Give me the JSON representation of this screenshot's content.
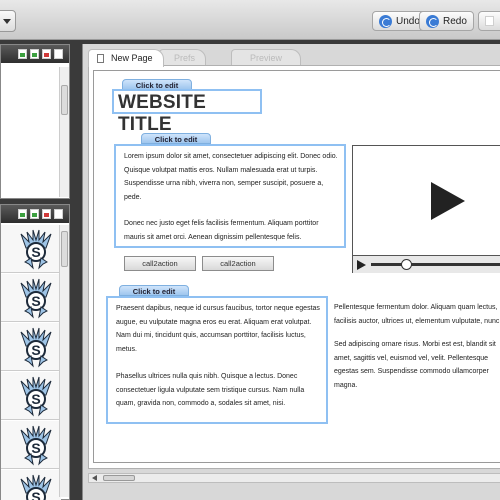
{
  "toolbar": {
    "undo_label": "Undo",
    "redo_label": "Redo"
  },
  "tabs": [
    {
      "label": "New Page",
      "active": true
    },
    {
      "label": "Prefs",
      "active": false
    },
    {
      "label": "Preview",
      "active": false
    }
  ],
  "canvas": {
    "edit_label": "Click to edit",
    "site_title": "WEBSITE TITLE",
    "block1_p1": "Lorem ipsum dolor sit amet, consectetuer adipiscing elit. Donec odio. Quisque volutpat mattis eros. Nullam malesuada erat ut turpis. Suspendisse urna nibh, viverra non, semper suscipit, posuere a, pede.",
    "block1_p2": "Donec nec justo eget felis facilisis fermentum. Aliquam porttitor mauris sit amet orci. Aenean dignissim pellentesque felis.",
    "cta1_label": "call2action",
    "cta2_label": "call2action",
    "block2_p1": "Praesent dapibus, neque id cursus faucibus, tortor neque egestas augue, eu vulputate magna eros eu erat. Aliquam erat volutpat. Nam dui mi, tincidunt quis, accumsan porttitor, facilisis luctus, metus.",
    "block2_p2": "Phasellus ultrices nulla quis nibh. Quisque a lectus. Donec consectetuer ligula vulputate sem tristique cursus. Nam nulla quam, gravida non, commodo a, sodales sit amet, nisi.",
    "side_p1": "Pellentesque fermentum dolor. Aliquam quam lectus, facilisis auctor, ultrices ut, elementum vulputate, nunc.",
    "side_p2": "Sed adipiscing ornare risus. Morbi est est, blandit sit amet, sagittis vel, euismod vel, velit. Pellentesque egestas sem. Suspendisse commodo ullamcorper magna."
  },
  "icons": {
    "undo": "undo-icon",
    "redo": "redo-icon",
    "video_play": "play-icon",
    "thumbnail": "hawk-mascot-icon"
  },
  "colors": {
    "accent_blue": "#3a7bd5",
    "edit_border": "#8fc0f2"
  }
}
